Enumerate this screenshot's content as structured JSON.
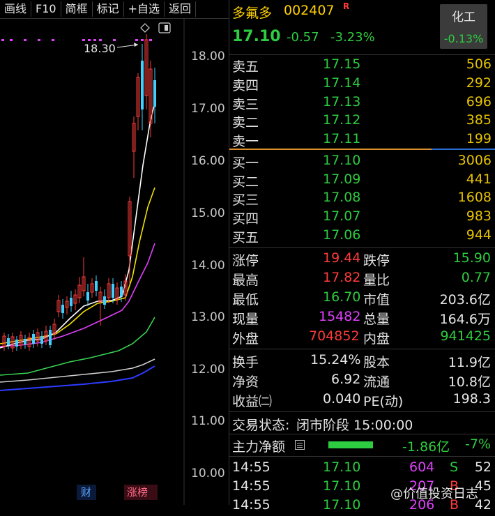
{
  "toolbar": {
    "items": [
      "画线",
      "F10",
      "简框",
      "标记",
      "+自选",
      "返回"
    ]
  },
  "chart": {
    "y_axis_labels": [
      "18.00",
      "17.00",
      "16.00",
      "15.00",
      "14.00",
      "13.00",
      "12.00",
      "11.00",
      "10.00"
    ],
    "high_marker": "18.30",
    "bottom_tags": [
      "财",
      "涨榜"
    ]
  },
  "stock": {
    "name": "多氟多",
    "code": "002407",
    "flag": "R",
    "price": "17.10",
    "change": "-0.57",
    "change_pct": "-3.23%",
    "sector_name": "化工",
    "sector_change": "-0.13%"
  },
  "asks": [
    {
      "label": "卖五",
      "price": "17.15",
      "volume": "506"
    },
    {
      "label": "卖四",
      "price": "17.14",
      "volume": "292"
    },
    {
      "label": "卖三",
      "price": "17.13",
      "volume": "696"
    },
    {
      "label": "卖二",
      "price": "17.12",
      "volume": "385"
    },
    {
      "label": "卖一",
      "price": "17.11",
      "volume": "199"
    }
  ],
  "bids": [
    {
      "label": "买一",
      "price": "17.10",
      "volume": "3006"
    },
    {
      "label": "买二",
      "price": "17.09",
      "volume": "441"
    },
    {
      "label": "买三",
      "price": "17.08",
      "volume": "1608"
    },
    {
      "label": "买四",
      "price": "17.07",
      "volume": "983"
    },
    {
      "label": "买五",
      "price": "17.06",
      "volume": "944"
    }
  ],
  "quote": {
    "limit_up_label": "涨停",
    "limit_up": "19.44",
    "limit_down_label": "跌停",
    "limit_down": "15.90",
    "high_label": "最高",
    "high": "17.82",
    "vol_ratio_label": "量比",
    "vol_ratio": "0.77",
    "low_label": "最低",
    "low": "16.70",
    "mkt_cap_label": "市值",
    "mkt_cap": "203.6亿",
    "cur_vol_label": "现量",
    "cur_vol": "15482",
    "total_vol_label": "总量",
    "total_vol": "164.6万",
    "outer_label": "外盘",
    "outer": "704852",
    "inner_label": "内盘",
    "inner": "941425",
    "turnover_label": "换手",
    "turnover": "15.24%",
    "shares_label": "股本",
    "shares": "11.9亿",
    "nav_label": "净资",
    "nav": "6.92",
    "float_label": "流通",
    "float": "10.8亿",
    "eps_label": "收益㈡",
    "eps": "0.040",
    "pe_label": "PE(动)",
    "pe": "198.3"
  },
  "status": {
    "label": "交易状态:",
    "value": "闭市阶段 15:00:00"
  },
  "capital": {
    "label": "主力净额",
    "amount": "-1.86亿",
    "pct": "-7%"
  },
  "ticks": [
    {
      "time": "14:55",
      "price": "17.10",
      "vol": "604",
      "side": "S",
      "num": "52"
    },
    {
      "time": "14:55",
      "price": "17.10",
      "vol": "207",
      "side": "B",
      "num": "45"
    },
    {
      "time": "14:55",
      "price": "17.10",
      "vol": "206",
      "side": "B",
      "num": "42"
    }
  ],
  "watermark": "@价值投资日志",
  "colors": {
    "up": "#ff3b3b",
    "down": "#2ecc40",
    "accent": "#ffd200",
    "volume": "#e6c200"
  }
}
